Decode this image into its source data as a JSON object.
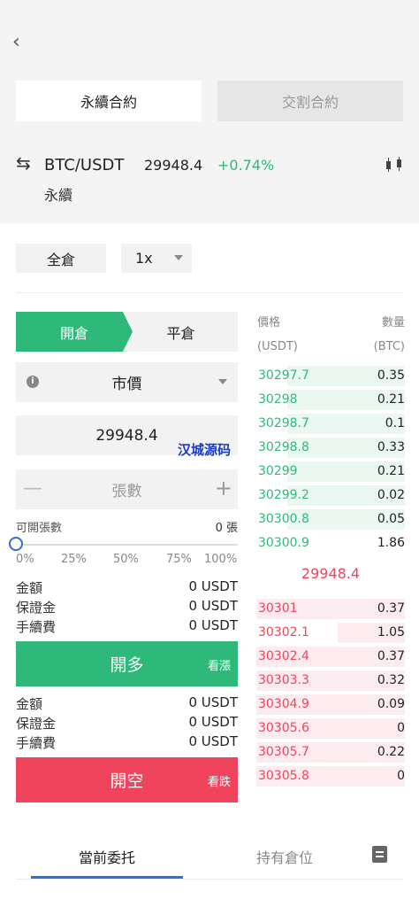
{
  "header": {
    "contract_tabs": [
      {
        "label": "永續合約",
        "active": true
      },
      {
        "label": "交割合約",
        "active": false
      }
    ],
    "pair": "BTC/USDT",
    "last_price": "29948.4",
    "change": "+0.74%",
    "contract_kind": "永續"
  },
  "settings": {
    "margin_mode": "全倉",
    "leverage": "1x"
  },
  "order_form": {
    "sides": {
      "open": "開倉",
      "close": "平倉"
    },
    "order_type": "市價",
    "price_value": "29948.4",
    "watermark": "汉城源码",
    "qty_placeholder": "張數",
    "available_label": "可開張數",
    "available_value": "0 張",
    "slider": {
      "value_percent": 0,
      "ticks": [
        "0%",
        "25%",
        "50%",
        "75%",
        "100%"
      ]
    },
    "long": {
      "rows": [
        {
          "label": "金額",
          "value": "0 USDT"
        },
        {
          "label": "保證金",
          "value": "0 USDT"
        },
        {
          "label": "手續費",
          "value": "0 USDT"
        }
      ],
      "button": "開多",
      "hint": "看漲"
    },
    "short": {
      "rows": [
        {
          "label": "金額",
          "value": "0 USDT"
        },
        {
          "label": "保證金",
          "value": "0 USDT"
        },
        {
          "label": "手續費",
          "value": "0 USDT"
        }
      ],
      "button": "開空",
      "hint": "看跌"
    }
  },
  "orderbook": {
    "price_header": "價格",
    "price_unit": "(USDT)",
    "qty_header": "數量",
    "qty_unit": "(BTC)",
    "bids": [
      {
        "price": "30297.7",
        "qty": "0.35",
        "depth": 0.79
      },
      {
        "price": "30298",
        "qty": "0.21",
        "depth": 0.79
      },
      {
        "price": "30298.7",
        "qty": "0.1",
        "depth": 0.79
      },
      {
        "price": "30298.8",
        "qty": "0.33",
        "depth": 0.79
      },
      {
        "price": "30299",
        "qty": "0.21",
        "depth": 0.79
      },
      {
        "price": "30299.2",
        "qty": "0.02",
        "depth": 0.79
      },
      {
        "price": "30300.8",
        "qty": "0.05",
        "depth": 0.79
      },
      {
        "price": "30300.9",
        "qty": "1.86",
        "depth": 0
      }
    ],
    "mid_price": "29948.4",
    "asks": [
      {
        "price": "30301",
        "qty": "0.37",
        "depth": 1
      },
      {
        "price": "30302.1",
        "qty": "1.05",
        "depth": 0.45
      },
      {
        "price": "30302.4",
        "qty": "0.37",
        "depth": 1
      },
      {
        "price": "30303.3",
        "qty": "0.32",
        "depth": 1
      },
      {
        "price": "30304.9",
        "qty": "0.09",
        "depth": 1
      },
      {
        "price": "30305.6",
        "qty": "0",
        "depth": 1
      },
      {
        "price": "30305.7",
        "qty": "0.22",
        "depth": 1
      },
      {
        "price": "30305.8",
        "qty": "0",
        "depth": 1
      }
    ]
  },
  "bottom_tabs": [
    {
      "label": "當前委托",
      "active": true
    },
    {
      "label": "持有倉位",
      "active": false
    }
  ],
  "colors": {
    "green": "#2eb97a",
    "red": "#f0445c",
    "blue": "#2f6fdc"
  }
}
